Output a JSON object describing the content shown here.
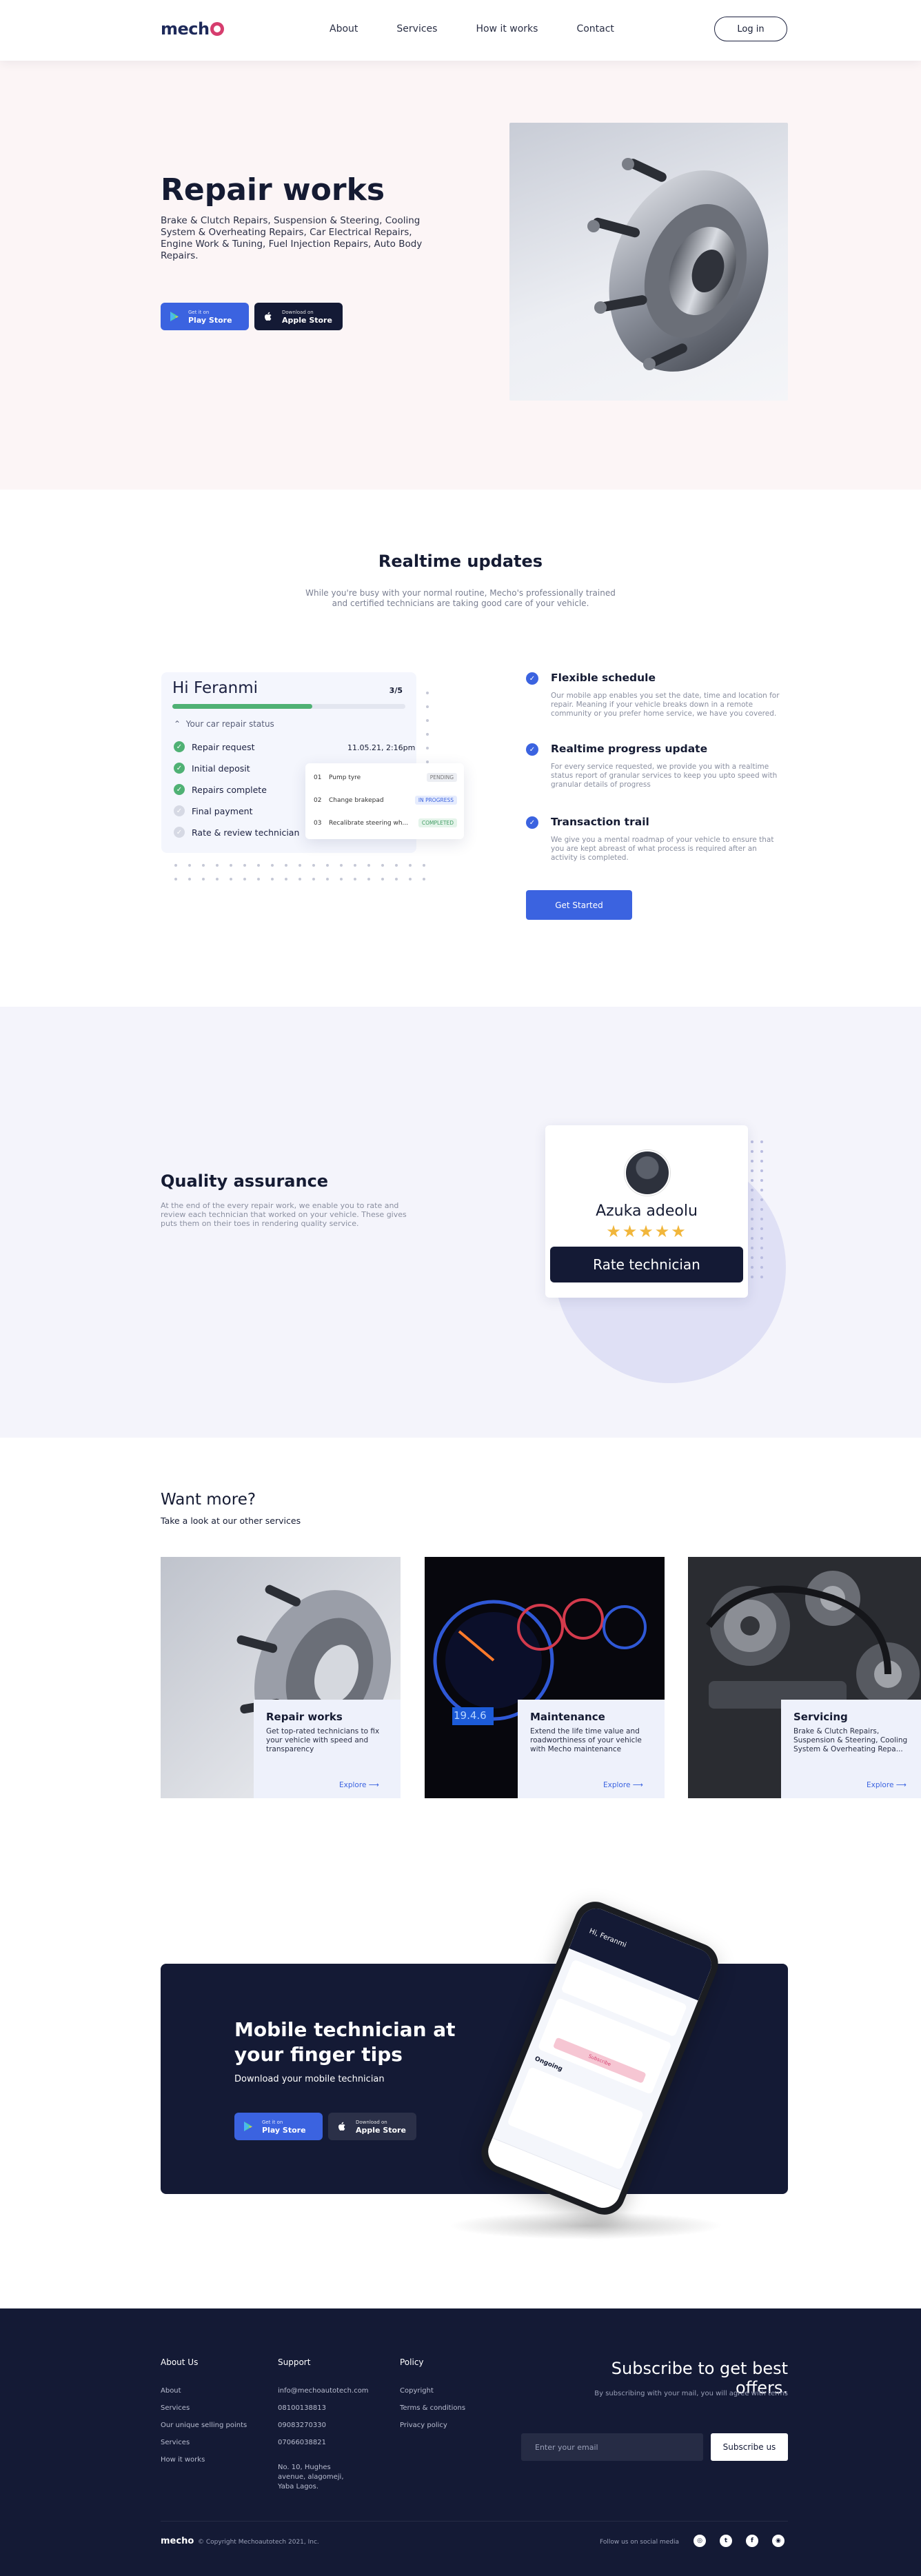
{
  "nav": {
    "logo": "mecho",
    "links": [
      "About",
      "Services",
      "How it works",
      "Contact"
    ],
    "login": "Log in"
  },
  "hero": {
    "title": "Repair works",
    "description": "Brake & Clutch Repairs, Suspension & Steering, Cooling System & Overheating Repairs, Car Electrical Repairs, Engine Work & Tuning, Fuel Injection Repairs, Auto Body Repairs.",
    "play": {
      "small": "Get it on",
      "big": "Play Store"
    },
    "apple": {
      "small": "Download on",
      "big": "Apple Store"
    }
  },
  "realtime": {
    "title": "Realtime updates",
    "subtitle": "While you're busy with your normal routine, Mecho's professionally trained and certified technicians are taking good care of your vehicle.",
    "card": {
      "greeting": "Hi Feranmi",
      "count": "3/5",
      "progress": 0.6,
      "status_label": "Your car repair status",
      "date": "11.05.21, 2:16pm",
      "steps": [
        {
          "label": "Repair request",
          "done": true
        },
        {
          "label": "Initial deposit",
          "done": true
        },
        {
          "label": "Repairs complete",
          "done": true
        },
        {
          "label": "Final payment",
          "done": false
        },
        {
          "label": "Rate & review technician",
          "done": false
        }
      ],
      "tasks": [
        {
          "num": "01",
          "name": "Pump tyre",
          "status": "PENDING"
        },
        {
          "num": "02",
          "name": "Change brakepad",
          "status": "IN PROGRESS"
        },
        {
          "num": "03",
          "name": "Recalibrate steering wh...",
          "status": "COMPLETED"
        }
      ]
    },
    "features": [
      {
        "title": "Flexible schedule",
        "text": "Our mobile app enables you set the date, time and location for repair. Meaning if your vehicle breaks down in a remote community or you prefer home service, we have you covered."
      },
      {
        "title": "Realtime progress update",
        "text": "For every service requested, we provide you with a realtime status report of granular services to keep you upto speed with granular details of progress"
      },
      {
        "title": "Transaction trail",
        "text": "We give you a mental roadmap of your vehicle to ensure that you are kept abreast of what process is required after an activity is completed."
      }
    ],
    "cta": "Get Started"
  },
  "quality": {
    "title": "Quality assurance",
    "text": "At the end of the every repair work, we enable you to rate and review each technician that worked on your vehicle. These gives puts them on their toes in rendering quality service.",
    "technician": "Azuka adeolu",
    "rating": 5,
    "stars": "★★★★★",
    "button": "Rate technician"
  },
  "more": {
    "title": "Want more?",
    "subtitle": "Take a look at our other services",
    "services": [
      {
        "title": "Repair works",
        "text": "Get top-rated technicians to fix your vehicle with speed and transparency",
        "link": "Explore"
      },
      {
        "title": "Maintenance",
        "text": "Extend the life time value and roadworthiness of your vehicle with Mecho maintenance",
        "link": "Explore"
      },
      {
        "title": "Servicing",
        "text": "Brake & Clutch Repairs, Suspension & Steering, Cooling System & Overheating Repa...",
        "link": "Explore"
      }
    ],
    "speed_readout": "19.4.6"
  },
  "mobile": {
    "title": "Mobile technician at your finger tips",
    "subtitle": "Download your mobile technician",
    "play": {
      "small": "Get it on",
      "big": "Play Store"
    },
    "apple": {
      "small": "Download on",
      "big": "Apple Store"
    },
    "phone": {
      "greeting": "Hi, Feranmi",
      "section": "Ongoing",
      "button": "Subscribe"
    }
  },
  "footer": {
    "about": {
      "title": "About Us",
      "items": [
        "About",
        "Services",
        "Our unique selling points",
        "Services",
        "How it works"
      ]
    },
    "support": {
      "title": "Support",
      "items": [
        "info@mechoautotech.com",
        "08100138813",
        "09083270330",
        "07066038821"
      ],
      "address": "No. 10, Hughes avenue, alagomeji, Yaba Lagos."
    },
    "policy": {
      "title": "Policy",
      "items": [
        "Copyright",
        "Terms & conditions",
        "Privacy policy"
      ]
    },
    "subscribe_title": "Subscribe to get best offers.",
    "subscribe_note": "By subscribing with your mail, you will agree with terms",
    "email_placeholder": "Enter your email",
    "subscribe_button": "Subscribe us",
    "logo": "mecho",
    "copyright": "© Copyright Mechoautotech 2021, Inc.",
    "follow": "Follow us on social media",
    "social_icons": [
      "instagram-icon",
      "twitter-icon",
      "facebook-icon",
      "discord-icon"
    ]
  },
  "colors": {
    "primary": "#3b63e0",
    "navy": "#141a35",
    "accent": "#d63d6e",
    "success": "#4fb174",
    "star": "#f1b63b",
    "hero_bg": "#fcf5f6",
    "quality_bg": "#f4f4fb"
  }
}
